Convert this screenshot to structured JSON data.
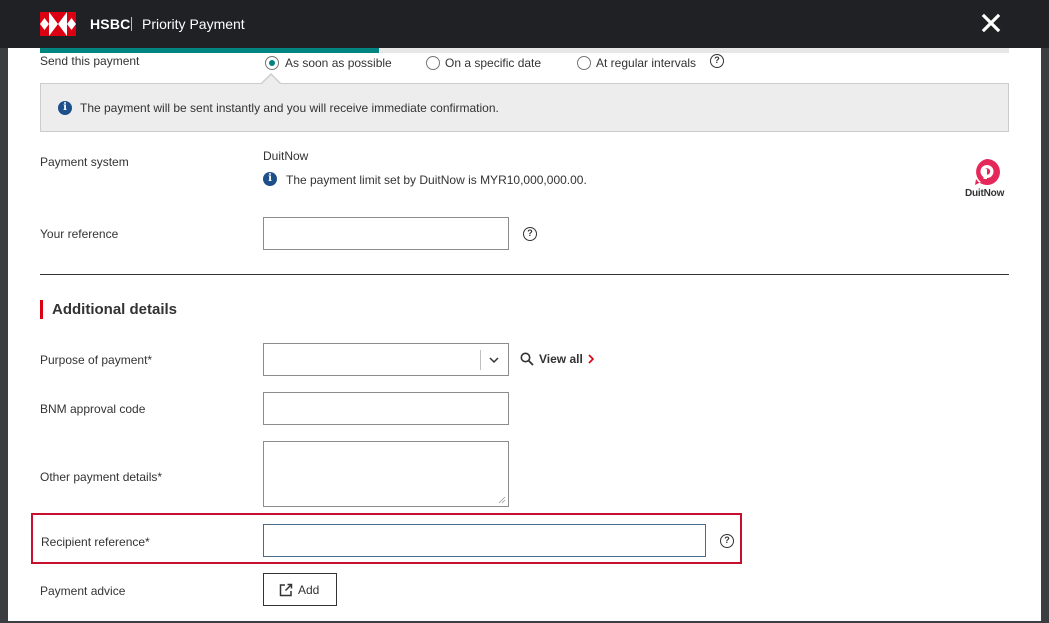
{
  "header": {
    "brand": "HSBC",
    "app_title": "Priority Payment",
    "close_icon": "close-icon"
  },
  "progress": {
    "completed_fraction": 0.35
  },
  "send_payment": {
    "label": "Send this payment",
    "options": [
      {
        "label": "As soon as possible",
        "selected": true
      },
      {
        "label": "On a specific date",
        "selected": false
      },
      {
        "label": "At regular intervals",
        "selected": false
      }
    ],
    "info_message": "The payment will be sent instantly and you will receive immediate confirmation."
  },
  "payment_system": {
    "label": "Payment system",
    "value": "DuitNow",
    "limit_note": "The payment limit set by DuitNow is MYR10,000,000.00.",
    "logo_text": "DuitNow"
  },
  "your_reference": {
    "label": "Your reference",
    "value": ""
  },
  "additional_details": {
    "title": "Additional details",
    "purpose": {
      "label": "Purpose of payment*",
      "value": "",
      "view_all": "View all"
    },
    "bnm_code": {
      "label": "BNM approval code",
      "value": ""
    },
    "other_details": {
      "label": "Other payment details*",
      "value": ""
    },
    "recipient_reference": {
      "label": "Recipient reference*",
      "value": ""
    },
    "payment_advice": {
      "label": "Payment advice",
      "add_label": "Add"
    }
  },
  "colors": {
    "header_bg": "#1f2124",
    "accent_teal": "#00847f",
    "hsbc_red": "#db0011",
    "info_blue": "#1d4f8a",
    "highlight_red": "#c8102e",
    "duitnow_pink": "#e5285a"
  }
}
